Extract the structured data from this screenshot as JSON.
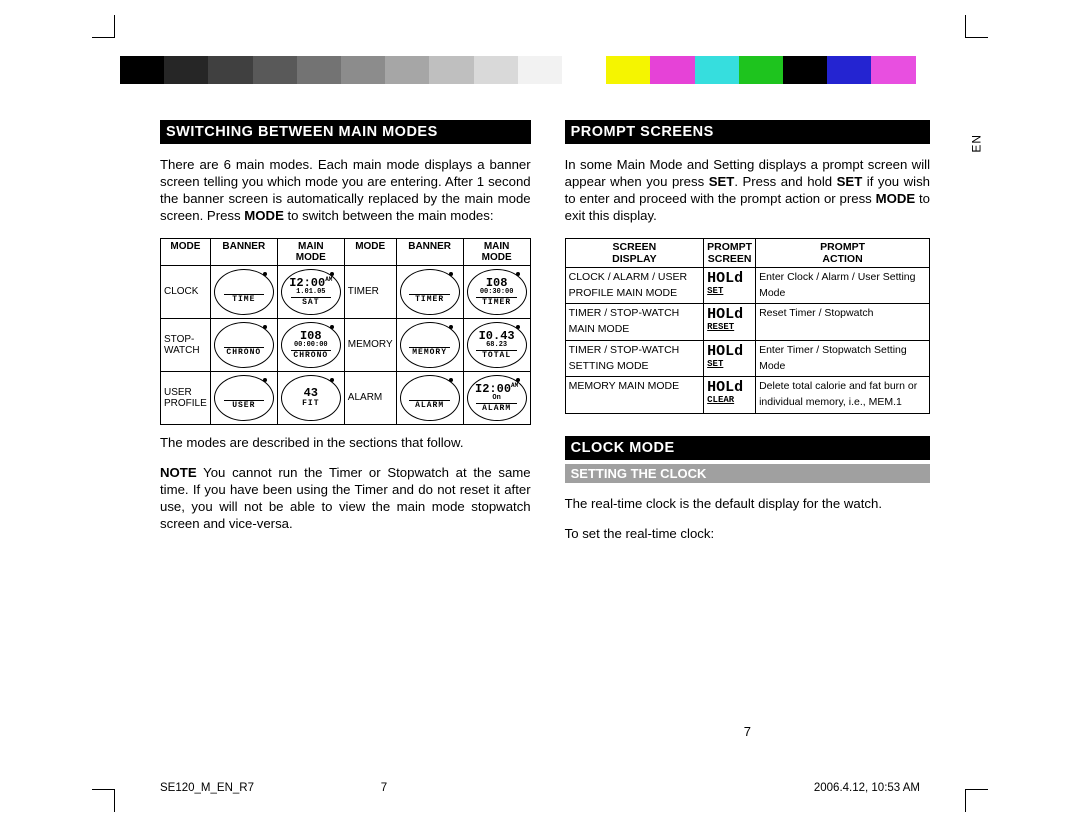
{
  "lang_tab": "EN",
  "colorbar": [
    "#000000",
    "#262626",
    "#404040",
    "#595959",
    "#737373",
    "#8c8c8c",
    "#a6a6a6",
    "#bfbfbf",
    "#d9d9d9",
    "#f2f2f2",
    "#ffffff",
    "#f5f500",
    "#e642d7",
    "#36dede",
    "#1ec41e",
    "#000000",
    "#2424d1",
    "#e84fe0",
    "#ffffff"
  ],
  "left_col": {
    "heading": "SWITCHING BETWEEN MAIN MODES",
    "intro_1": "There are 6 main modes. Each main mode displays a banner screen telling you which mode you are entering. After 1 second the banner screen is automatically replaced by the main mode screen. Press ",
    "intro_mode": "MODE",
    "intro_2": " to switch between the main modes:",
    "modes_headers": [
      "MODE",
      "BANNER",
      "MAIN MODE",
      "MODE",
      "BANNER",
      "MAIN MODE"
    ],
    "modes_rows": [
      {
        "m1": "CLOCK",
        "b1": "TIME",
        "mm1": {
          "r1": "I2:00",
          "ampm": "AM",
          "r2": "1.01.05",
          "r3": "SAT"
        },
        "m2": "TIMER",
        "b2": "TIMER",
        "mm2": {
          "r1": "I08",
          "ampm": "",
          "r2": "00:30:00",
          "r3": "TIMER"
        }
      },
      {
        "m1": "STOP-WATCH",
        "b1": "CHRONO",
        "mm1": {
          "r1": "I08",
          "ampm": "",
          "r2": "00:00:00",
          "r3": "CHRONO"
        },
        "m2": "MEMORY",
        "b2": "MEMORY",
        "mm2": {
          "r1": "I0.43",
          "ampm": "",
          "r2": "68.23",
          "r3": "TOTAL"
        }
      },
      {
        "m1": "USER PROFILE",
        "b1": "USER",
        "mm1": {
          "r1": "43",
          "ampm": "",
          "r2": "",
          "r3": "FIT"
        },
        "m2": "ALARM",
        "b2": "ALARM",
        "mm2": {
          "r1": "I2:00",
          "ampm": "AM",
          "r2": "On",
          "r3": "ALARM"
        }
      }
    ],
    "after_table": "The modes are described in the sections that follow.",
    "note_label": "NOTE",
    "note_text": " You cannot run the Timer or Stopwatch at the same time. If you have been using the Timer and do not reset it after use, you will not be able to view the main mode stopwatch screen and vice-versa."
  },
  "right_col": {
    "heading1": "PROMPT SCREENS",
    "p1_a": "In some Main Mode and Setting displays a prompt screen will appear when you press ",
    "p1_set1": "SET",
    "p1_b": ". Press and hold ",
    "p1_set2": "SET",
    "p1_c": " if you wish to enter and proceed with the prompt action or press ",
    "p1_mode": "MODE",
    "p1_d": " to exit this display.",
    "prompt_headers": [
      "SCREEN DISPLAY",
      "PROMPT SCREEN",
      "PROMPT ACTION"
    ],
    "prompt_rows": [
      {
        "d": "CLOCK / ALARM / USER PROFILE MAIN MODE",
        "s": {
          "h": "HOLd",
          "s": "SET"
        },
        "a": "Enter Clock / Alarm / User Setting Mode"
      },
      {
        "d": "TIMER / STOP-WATCH MAIN MODE",
        "s": {
          "h": "HOLd",
          "s": "RESET"
        },
        "a": "Reset Timer / Stopwatch"
      },
      {
        "d": "TIMER / STOP-WATCH SETTING MODE",
        "s": {
          "h": "HOLd",
          "s": "SET"
        },
        "a": "Enter Timer / Stopwatch Setting Mode"
      },
      {
        "d": "MEMORY MAIN MODE",
        "s": {
          "h": "HOLd",
          "s": "CLEAR"
        },
        "a": "Delete total calorie and fat burn or individual memory, i.e., MEM.1"
      }
    ],
    "heading2": "CLOCK MODE",
    "sub1": "SETTING THE CLOCK",
    "clock_p1": "The real-time clock is the default display for the watch.",
    "clock_p2": "To set the real-time clock:"
  },
  "page_number": "7",
  "footer": {
    "doc": "SE120_M_EN_R7",
    "page": "7",
    "date": "2006.4.12, 10:53 AM"
  }
}
